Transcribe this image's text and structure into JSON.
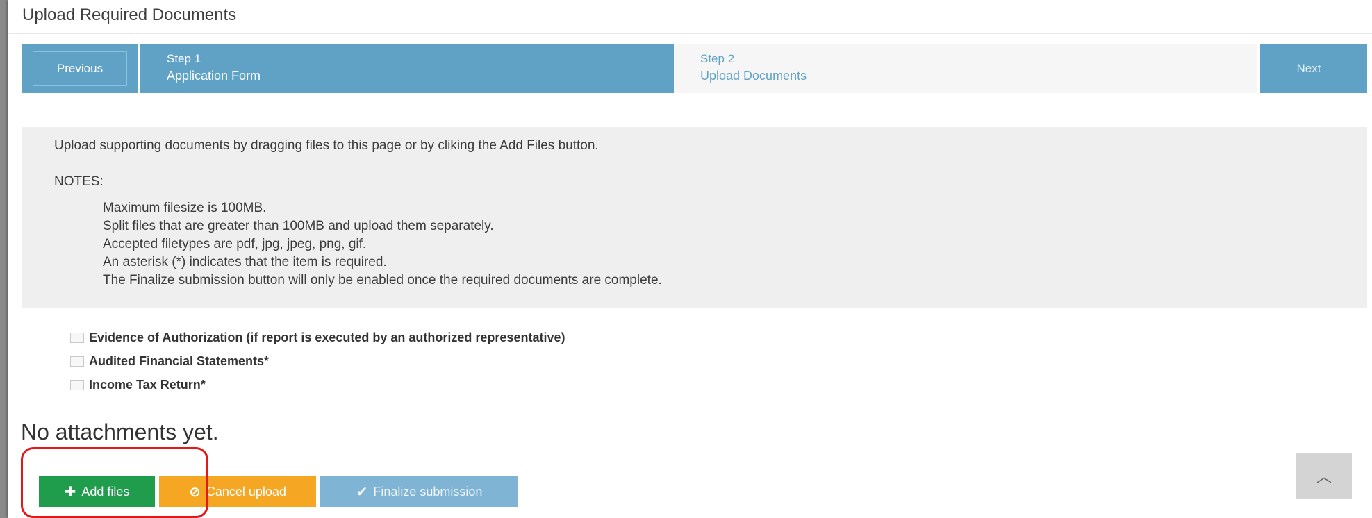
{
  "title": "Upload Required Documents",
  "wizard": {
    "previous_label": "Previous",
    "next_label": "Next",
    "steps": [
      {
        "number": "Step 1",
        "label": "Application Form",
        "state": "completed"
      },
      {
        "number": "Step 2",
        "label": "Upload Documents",
        "state": "current"
      }
    ]
  },
  "notes": {
    "intro": "Upload supporting documents by dragging files to this page or by cliking the Add Files button.",
    "heading": "NOTES:",
    "items": [
      "Maximum filesize is 100MB.",
      "Split files that are greater than 100MB and upload them separately.",
      "Accepted filetypes are pdf, jpg, jpeg, png, gif.",
      "An asterisk (*) indicates that the item is required.",
      "The Finalize submission button will only be enabled once the required documents are complete."
    ]
  },
  "required_docs": [
    {
      "label": "Evidence of Authorization (if report is executed by an authorized representative)",
      "checked": false
    },
    {
      "label": "Audited Financial Statements*",
      "checked": false
    },
    {
      "label": "Income Tax Return*",
      "checked": false
    }
  ],
  "attachments_status": "No attachments yet.",
  "actions": {
    "add_files": "Add files",
    "cancel_upload": "Cancel upload",
    "finalize": "Finalize submission"
  },
  "icons": {
    "add": "plus-icon",
    "cancel": "ban-icon",
    "finalize": "check-icon",
    "scroll_top": "chevron-up-icon"
  },
  "colors": {
    "wizard_blue": "#5fa2c6",
    "add_green": "#1f9d4d",
    "cancel_orange": "#f5a623",
    "finalize_blue": "#7fb4d4",
    "highlight_red": "#e51717"
  }
}
